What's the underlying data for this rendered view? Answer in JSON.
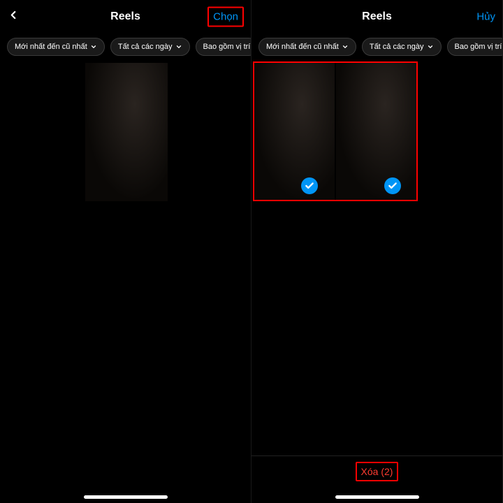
{
  "left": {
    "header": {
      "title": "Reels",
      "action": "Chọn"
    },
    "filters": [
      {
        "label": "Mới nhất đến cũ nhất",
        "dropdown": true
      },
      {
        "label": "Tất cả các ngày",
        "dropdown": true
      },
      {
        "label": "Bao gồm vị trí",
        "dropdown": false
      }
    ]
  },
  "right": {
    "header": {
      "title": "Reels",
      "action": "Hủy"
    },
    "filters": [
      {
        "label": "Mới nhất đến cũ nhất",
        "dropdown": true
      },
      {
        "label": "Tất cả các ngày",
        "dropdown": true
      },
      {
        "label": "Bao gồm vị trí",
        "dropdown": false
      }
    ],
    "bottom": {
      "delete_label": "Xóa (2)"
    }
  }
}
